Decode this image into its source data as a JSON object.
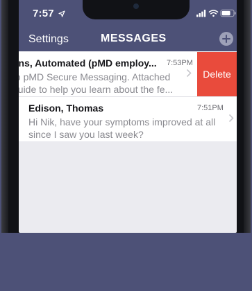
{
  "status_bar": {
    "time": "7:57",
    "location_icon": "location-arrow-icon",
    "signal_icon": "cellular-signal-icon",
    "wifi_icon": "wifi-icon",
    "battery_icon": "battery-icon"
  },
  "nav": {
    "back_label": "Settings",
    "title": "MESSAGES",
    "add_icon": "plus-icon"
  },
  "messages": [
    {
      "sender": "ons, Automated (pMD employ...",
      "time": "7:53PM",
      "preview_line1": " to pMD Secure Messaging. Attached",
      "preview_line2": "guide to help you learn about the fe...",
      "swiped": true
    },
    {
      "sender": "Edison, Thomas",
      "time": "7:51PM",
      "preview_line1": "Hi Nik, have your symptoms improved at all",
      "preview_line2": "since I saw you last week?",
      "swiped": false
    }
  ],
  "swipe_action": {
    "label": "Delete",
    "color": "#e94b3c"
  },
  "colors": {
    "header": "#4d5177",
    "list_background": "#ebebf0"
  }
}
